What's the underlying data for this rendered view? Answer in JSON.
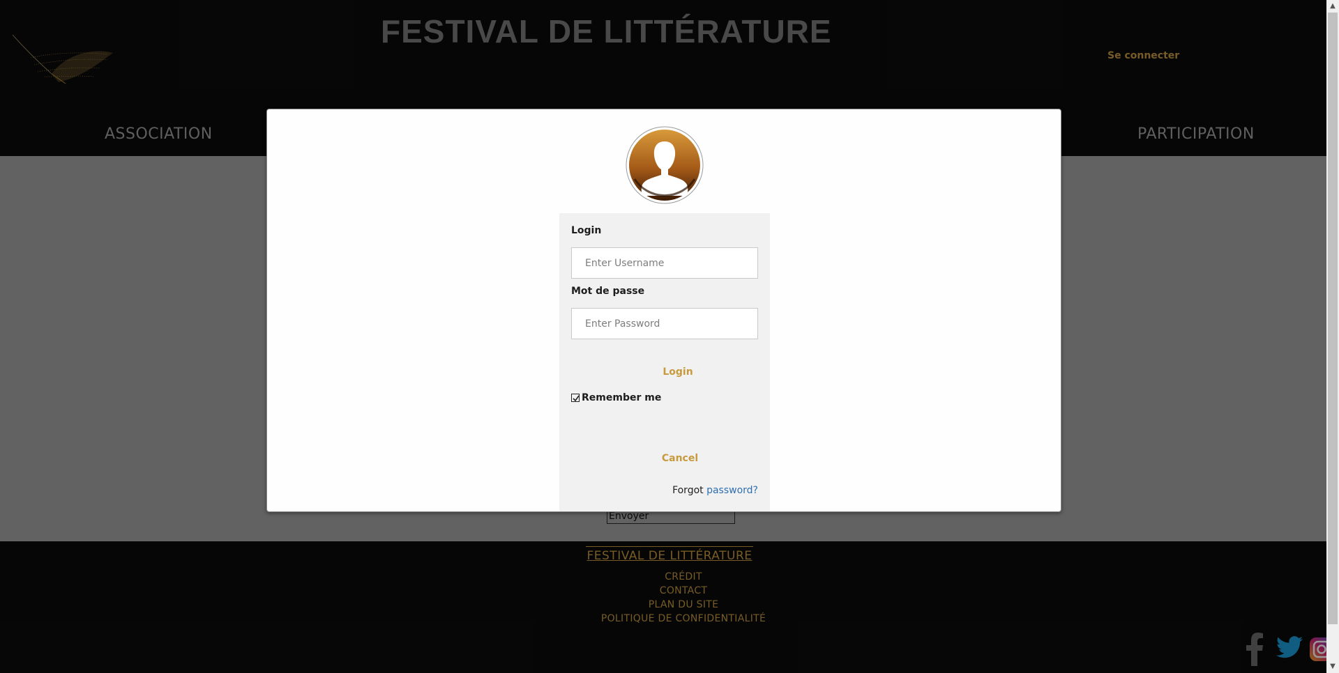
{
  "header": {
    "site_title": "FESTIVAL DE LITTÉRATURE",
    "login_link": "Se connecter",
    "nav": [
      "ASSOCIATION",
      "PARTICIPATION"
    ]
  },
  "content": {
    "submit_label": "Envoyer"
  },
  "modal": {
    "username_label": "Login",
    "username_placeholder": "Enter Username",
    "password_label": "Mot de passe",
    "password_placeholder": "Enter Password",
    "login_button": "Login",
    "remember_label": "Remember me",
    "remember_checked": true,
    "cancel_button": "Cancel",
    "forgot_prefix": "Forgot",
    "forgot_link": "password?"
  },
  "footer": {
    "title": "FESTIVAL DE LITTÉRATURE",
    "links": [
      "CRÉDIT",
      "CONTACT",
      "PLAN DU SITE",
      "POLITIQUE DE CONFIDENTIALITÉ"
    ]
  },
  "social": [
    "facebook-icon",
    "twitter-icon",
    "instagram-icon"
  ],
  "colors": {
    "accent_gold": "#c79a3e",
    "link_blue": "#2f6fb0",
    "header_bg": "#0b0b0b",
    "content_bg": "#a3a3a3"
  }
}
